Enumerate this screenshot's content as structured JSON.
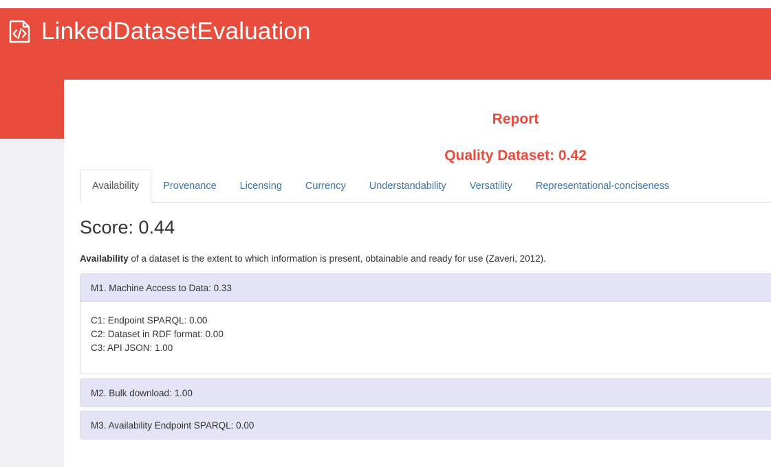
{
  "app": {
    "title": "LinkedDatasetEvaluation",
    "icon": "code-file-icon"
  },
  "report": {
    "title": "Report",
    "quality_label": "Quality Dataset: 0.42"
  },
  "tabs": [
    {
      "label": "Availability",
      "active": true
    },
    {
      "label": "Provenance",
      "active": false
    },
    {
      "label": "Licensing",
      "active": false
    },
    {
      "label": "Currency",
      "active": false
    },
    {
      "label": "Understandability",
      "active": false
    },
    {
      "label": "Versatility",
      "active": false
    },
    {
      "label": "Representational-conciseness",
      "active": false
    }
  ],
  "main": {
    "score_label": "Score: 0.44",
    "description_term": "Availability",
    "description_text": " of a dataset is the extent to which information is present, obtainable and ready for use (Zaveri, 2012)."
  },
  "metrics": [
    {
      "title": "M1. Machine Access to Data: 0.33",
      "expanded": true,
      "criteria": [
        "C1: Endpoint SPARQL: 0.00",
        "C2: Dataset in RDF format: 0.00",
        "C3: API JSON: 1.00"
      ]
    },
    {
      "title": "M2. Bulk download: 1.00",
      "expanded": false,
      "criteria": []
    },
    {
      "title": "M3. Availability Endpoint SPARQL: 0.00",
      "expanded": false,
      "criteria": []
    }
  ],
  "colors": {
    "brand": "#e84c3d",
    "link": "#3b73b3",
    "panel_head": "#e4e4f6"
  }
}
